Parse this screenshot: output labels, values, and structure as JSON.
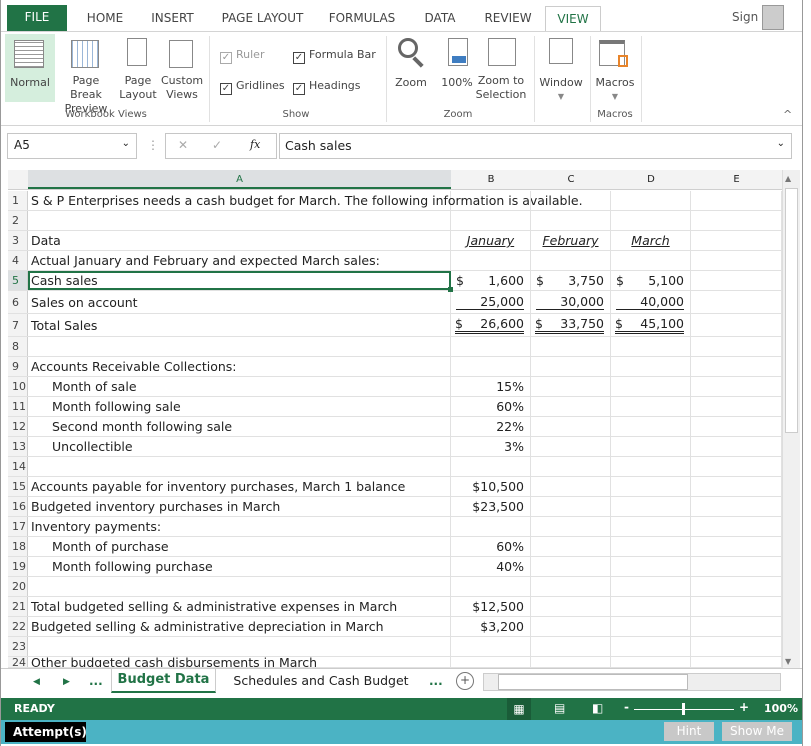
{
  "ribbon": {
    "tabs": [
      "FILE",
      "HOME",
      "INSERT",
      "PAGE LAYOUT",
      "FORMULAS",
      "DATA",
      "REVIEW",
      "VIEW"
    ],
    "active_tab": "VIEW",
    "sign_in": "Sign In",
    "workbook_views": {
      "normal": "Normal",
      "page_break": [
        "Page Break",
        "Preview"
      ],
      "page_layout": [
        "Page",
        "Layout"
      ],
      "custom": [
        "Custom",
        "Views"
      ],
      "group": "Workbook Views"
    },
    "show": {
      "ruler": "Ruler",
      "formula_bar": "Formula Bar",
      "gridlines": "Gridlines",
      "headings": "Headings",
      "group": "Show"
    },
    "zoom": {
      "zoom": "Zoom",
      "hundred": "100%",
      "zoom_to": [
        "Zoom to",
        "Selection"
      ],
      "group": "Zoom"
    },
    "window": {
      "label": "Window"
    },
    "macros": {
      "label": "Macros",
      "group": "Macros"
    }
  },
  "formula_bar": {
    "name_box": "A5",
    "fx": "fx",
    "value": "Cash sales"
  },
  "columns": [
    "A",
    "B",
    "C",
    "D",
    "E"
  ],
  "rows": [
    {
      "n": "1",
      "a": "S & P Enterprises needs a cash budget for March. The following information is available."
    },
    {
      "n": "2",
      "a": ""
    },
    {
      "n": "3",
      "a": "Data",
      "b": "January",
      "c": "February",
      "d": "March"
    },
    {
      "n": "4",
      "a": "Actual January and February and expected March sales:"
    },
    {
      "n": "5",
      "a": "Cash sales",
      "b": "1,600",
      "c": "3,750",
      "d": "5,100"
    },
    {
      "n": "6",
      "a": "Sales on account",
      "b": "25,000",
      "c": "30,000",
      "d": "40,000"
    },
    {
      "n": "7",
      "a": "Total Sales",
      "b": "26,600",
      "c": "33,750",
      "d": "45,100"
    },
    {
      "n": "8",
      "a": ""
    },
    {
      "n": "9",
      "a": "Accounts Receivable Collections:"
    },
    {
      "n": "10",
      "a": "Month of sale",
      "b": "15%"
    },
    {
      "n": "11",
      "a": "Month following sale",
      "b": "60%"
    },
    {
      "n": "12",
      "a": "Second month following sale",
      "b": "22%"
    },
    {
      "n": "13",
      "a": "Uncollectible",
      "b": "3%"
    },
    {
      "n": "14",
      "a": ""
    },
    {
      "n": "15",
      "a": "Accounts payable for inventory purchases, March 1 balance",
      "b": "$10,500"
    },
    {
      "n": "16",
      "a": "Budgeted inventory purchases in March",
      "b": "$23,500"
    },
    {
      "n": "17",
      "a": "Inventory payments:"
    },
    {
      "n": "18",
      "a": "Month of purchase",
      "b": "60%"
    },
    {
      "n": "19",
      "a": "Month following purchase",
      "b": "40%"
    },
    {
      "n": "20",
      "a": ""
    },
    {
      "n": "21",
      "a": "Total budgeted selling & administrative expenses in March",
      "b": "$12,500"
    },
    {
      "n": "22",
      "a": "Budgeted selling & administrative depreciation in March",
      "b": "$3,200"
    },
    {
      "n": "23",
      "a": ""
    },
    {
      "n": "24",
      "a": "Other budgeted cash disbursements in March"
    }
  ],
  "currency": "$",
  "sheets": {
    "active": "Budget Data",
    "other": "Schedules and Cash Budget",
    "more": "..."
  },
  "status": {
    "ready": "READY",
    "zoom": "100%"
  },
  "footer": {
    "attempts": "Attempt(s)",
    "hint": "Hint",
    "show_me": "Show Me"
  },
  "colors": {
    "accent": "#217346",
    "footer_bar": "#4bb3c4"
  }
}
